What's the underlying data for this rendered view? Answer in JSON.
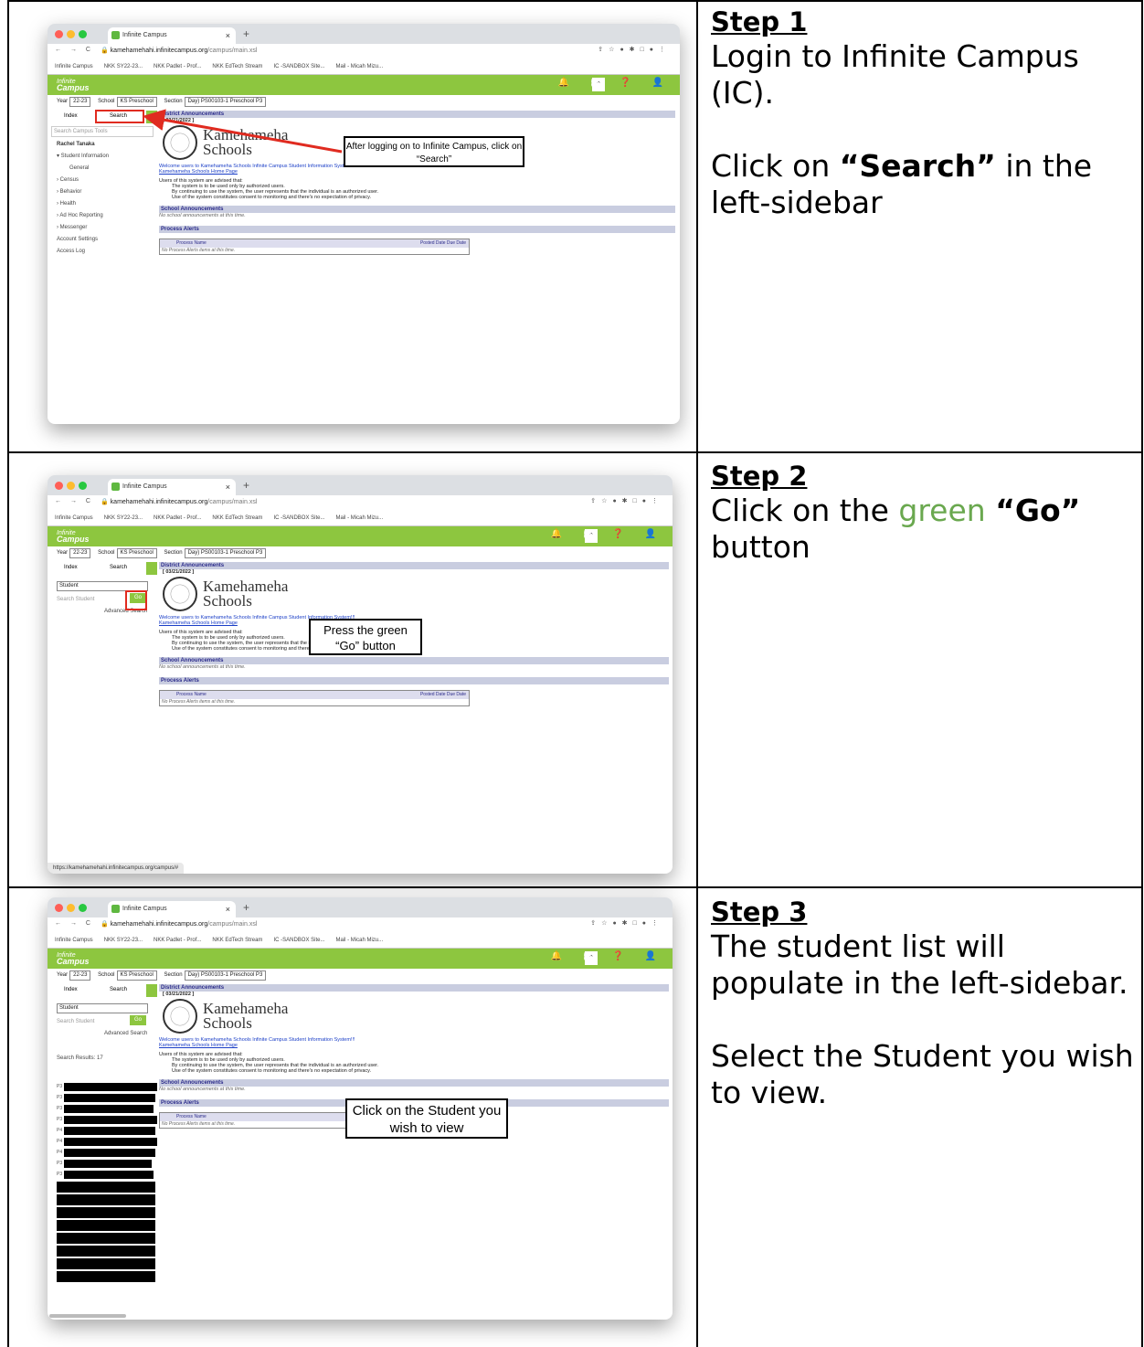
{
  "steps": [
    {
      "title": "Step 1",
      "line1": "Login to Infinite Campus (IC).",
      "p2_pre": "Click on ",
      "p2_bold": "“Search”",
      "p2_post": " in the left-sidebar"
    },
    {
      "title": "Step 2",
      "p1_pre": "Click on the ",
      "p1_green": "green",
      "p1_bold": "“Go”",
      "p1_post": "button"
    },
    {
      "title": "Step 3",
      "line1": "The student list will populate in the left-sidebar.",
      "line2": "Select the Student you wish to view."
    }
  ],
  "browser": {
    "tab_title": "Infinite Campus",
    "tab_close": "×",
    "new_tab": "+",
    "nav": "← → C",
    "url_host": "kamehamehahi.infinitecampus.org",
    "url_path": "/campus/main.xsl",
    "bookmarks": [
      "Infinite Campus",
      "NKK SY22-23...",
      "NKK Padlet - Prof...",
      "NKK EdTech Stream",
      "IC -SANDBOX Site...",
      "Mail - Micah Mizu..."
    ]
  },
  "ic": {
    "logo_top": "Infinite",
    "logo_bottom": "Campus",
    "year_label": "Year",
    "year_value": "22-23",
    "school_label": "School",
    "school_value": "KS Preschool",
    "section_label": "Section",
    "section_value": "Day) PS00103-1 Preschool P3",
    "tab_index": "Index",
    "tab_search": "Search",
    "search_tools_placeholder": "Search Campus Tools",
    "user_name": "Rachel Tanaka",
    "menu": [
      "▾ Student Information",
      "General",
      "› Census",
      "› Behavior",
      "› Health",
      "› Ad Hoc Reporting",
      "› Messenger",
      "Account Settings",
      "Access Log"
    ],
    "student_select": "Student",
    "search_student_placeholder": "Search Student",
    "go": "Go",
    "advanced_search": "Advanced Search",
    "search_results": "Search Results: 17",
    "result_prefixes": [
      "P3",
      "P3",
      "P3",
      "P3",
      "P4",
      "P4",
      "P4",
      "P3",
      "P3"
    ],
    "district_announcements": "District Announcements",
    "date": "[ 03/21/2022 ]",
    "ks_name_1": "Kamehameha",
    "ks_name_2": "Schools",
    "welcome": "Welcome users to Kamehameha Schools Infinite Campus Student Information System!!!",
    "home_link": "Kamehameha Schools Home Page",
    "advised": "Users of this system are advised that:",
    "bullets": [
      "The system is to be used only by authorized users.",
      "By continuing to use the system, the user represents that the individual is an authorized user.",
      "Use of the system constitutes consent to monitoring and there's no expectation of privacy."
    ],
    "school_announcements": "School Announcements",
    "no_school_ann": "No school announcements at this time.",
    "process_alerts": "Process Alerts",
    "pa_col_process": "Process",
    "pa_col_name": "Name",
    "pa_col_dates": "Posted Date Due Date",
    "no_alerts": "No Process Alerts items at this time."
  },
  "callouts": {
    "c1": "After logging on to Infinite Campus, click on “Search”",
    "c2": "Press the green “Go” button",
    "c3": "Click on the Student you wish to view"
  },
  "status_url": "https://kamehamehahi.infinitecampus.org/campus/#",
  "colors": {
    "ic_green": "#8dc63f",
    "callout_red": "#e02b20",
    "text_green": "#6aa84f"
  }
}
